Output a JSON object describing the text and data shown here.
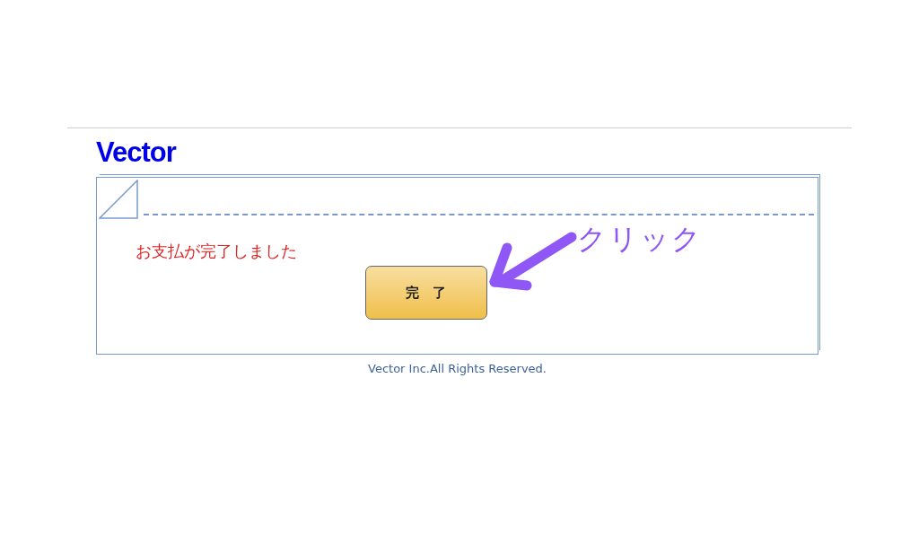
{
  "logo": "Vector",
  "message": "お支払が完了しました",
  "button": {
    "label": "完　了"
  },
  "annotation": {
    "label": "クリック"
  },
  "footer": "Vector Inc.All Rights Reserved."
}
